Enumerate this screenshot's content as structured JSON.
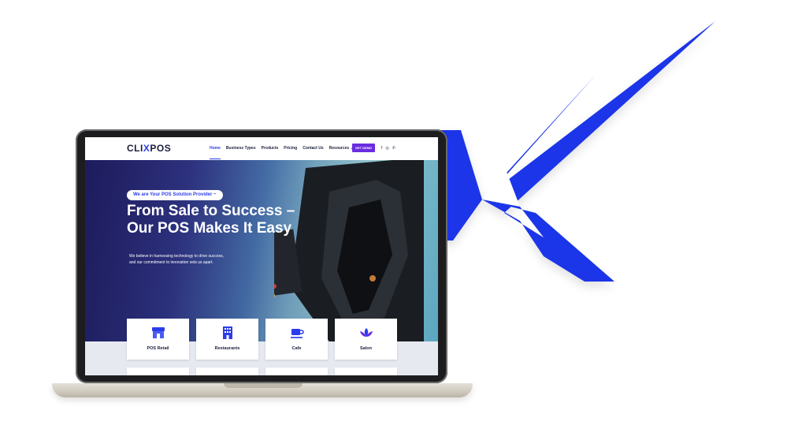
{
  "nav": {
    "logo_left": "CLI",
    "logo_x": "X",
    "logo_right": "POS",
    "items": [
      "Home",
      "Business Types",
      "Products",
      "Pricing",
      "Contact Us",
      "Resources ⌄"
    ],
    "cta": "GET DEMO",
    "social_icons": [
      "facebook-icon",
      "instagram-icon",
      "whatsapp-icon"
    ]
  },
  "hero": {
    "badge": "We are Your POS Solution Provider ~",
    "headline_line1": "From Sale to Success –",
    "headline_line2": "Our POS Makes It Easy",
    "sub_line1": "We believe in harnessing technology to drive success,",
    "sub_line2": "and our commitment to innovation sets us apart."
  },
  "business_types": [
    {
      "label": "POS Retail",
      "icon": "store-icon"
    },
    {
      "label": "Restaurants",
      "icon": "building-icon"
    },
    {
      "label": "Cafe",
      "icon": "coffee-cup-icon"
    },
    {
      "label": "Salon",
      "icon": "lotus-icon"
    }
  ],
  "colors": {
    "brand_blue": "#2b3de8",
    "cta_purple": "#6a2ce0",
    "dark_text": "#1b1f3b"
  }
}
